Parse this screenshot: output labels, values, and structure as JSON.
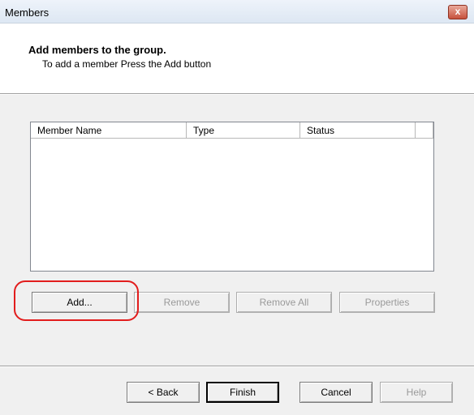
{
  "window": {
    "title": "Members",
    "close_symbol": "x"
  },
  "header": {
    "title": "Add members to the group.",
    "subtitle": "To add a member Press the Add button"
  },
  "member_list": {
    "columns": [
      "Member Name",
      "Type",
      "Status"
    ],
    "rows": []
  },
  "actions": {
    "add": "Add...",
    "remove": "Remove",
    "remove_all": "Remove All",
    "properties": "Properties"
  },
  "wizard_nav": {
    "back": "< Back",
    "finish": "Finish",
    "cancel": "Cancel",
    "help": "Help"
  },
  "colors": {
    "highlight": "#e21d1d",
    "dialog_bg": "#f0f0f0"
  }
}
